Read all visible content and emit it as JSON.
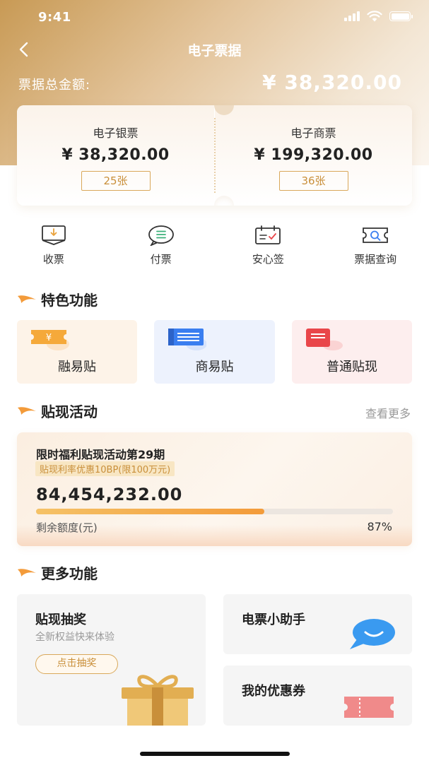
{
  "status_bar": {
    "time": "9:41"
  },
  "nav": {
    "title": "电子票据"
  },
  "total": {
    "label": "票据总金额:",
    "amount": "¥ 38,320.00"
  },
  "tickets": [
    {
      "name": "电子银票",
      "amount": "¥ 38,320.00",
      "count": "25张"
    },
    {
      "name": "电子商票",
      "amount": "¥ 199,320.00",
      "count": "36张"
    }
  ],
  "quick_actions": [
    {
      "label": "收票",
      "icon": "receive-ticket-icon"
    },
    {
      "label": "付票",
      "icon": "pay-ticket-icon"
    },
    {
      "label": "安心签",
      "icon": "sign-icon"
    },
    {
      "label": "票据查询",
      "icon": "ticket-search-icon"
    }
  ],
  "featured": {
    "title": "特色功能",
    "items": [
      {
        "label": "融易贴",
        "icon": "yen-ticket-icon",
        "color": "#f5a93a"
      },
      {
        "label": "商易贴",
        "icon": "list-card-icon",
        "color": "#3a7ef0"
      },
      {
        "label": "普通贴现",
        "icon": "discount-card-icon",
        "color": "#e9464a"
      }
    ]
  },
  "activity": {
    "title": "贴现活动",
    "more": "查看更多",
    "card_title": "限时福利贴现活动第29期",
    "badge": "贴现利率优惠10BP(限100万元)",
    "amount": "84,454,232.00",
    "remaining_label": "剩余额度(元)",
    "percent_text": "87%",
    "progress_fraction": 0.64
  },
  "more_functions": {
    "title": "更多功能",
    "lottery": {
      "title": "贴现抽奖",
      "subtitle": "全新权益快来体验",
      "button": "点击抽奖"
    },
    "assistant": {
      "title": "电票小助手"
    },
    "coupon": {
      "title": "我的优惠券"
    }
  },
  "colors": {
    "gold": "#d9a85a",
    "accent_text": "#c98f3a",
    "progress_start": "#f5c267",
    "progress_end": "#f39b3a"
  }
}
